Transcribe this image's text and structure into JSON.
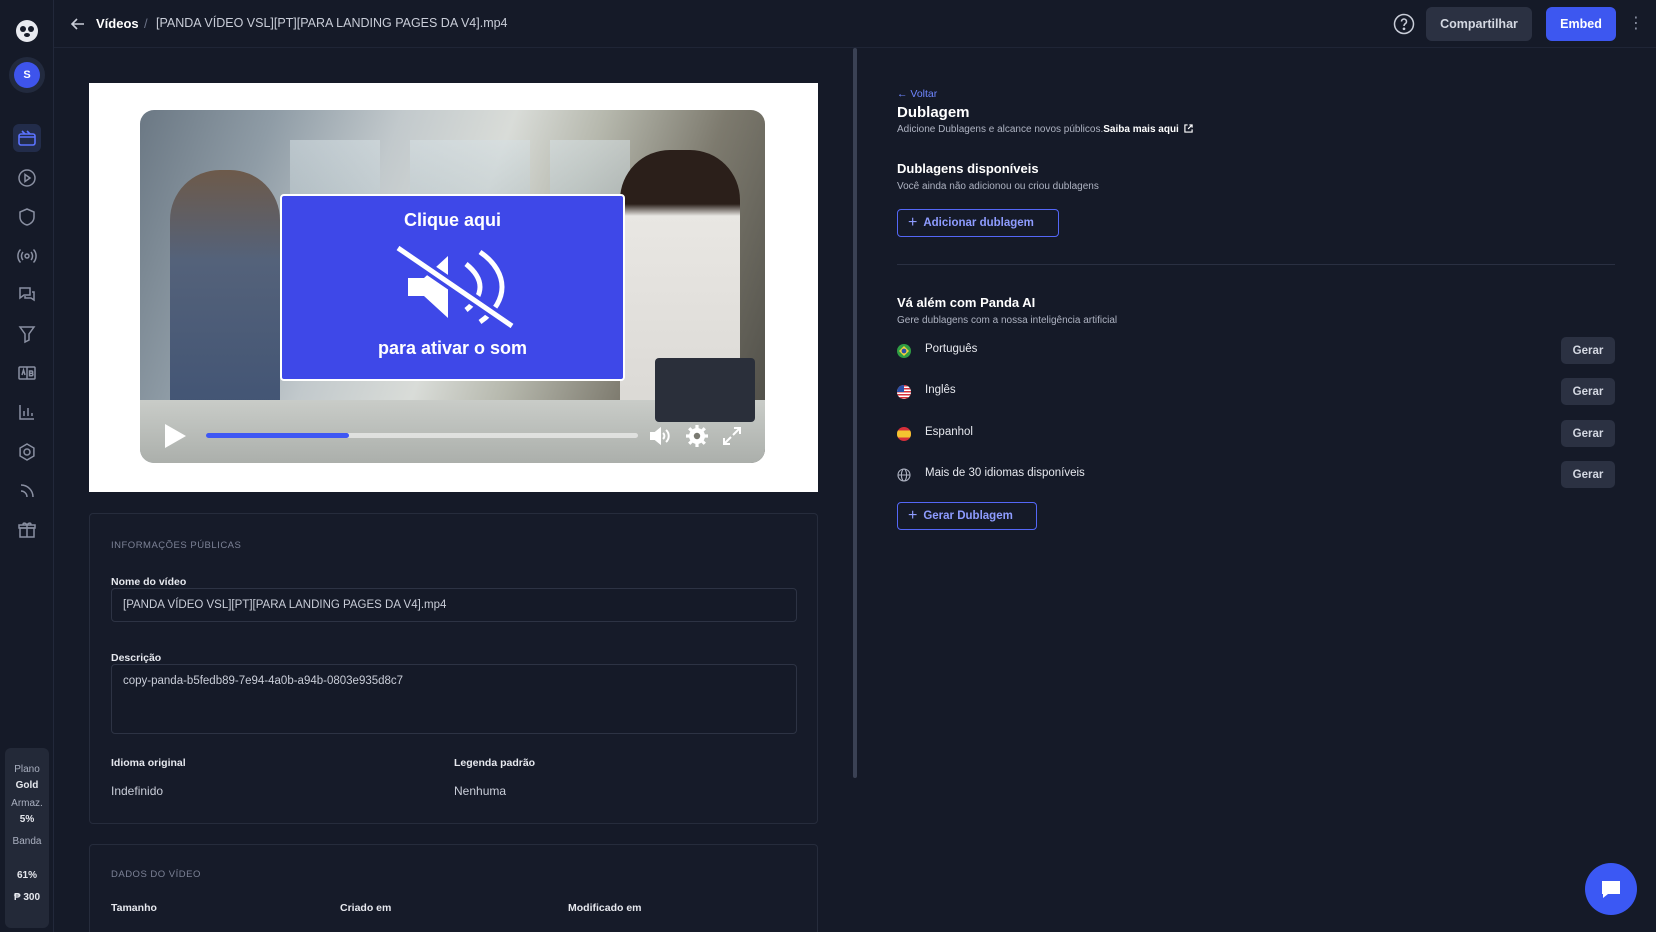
{
  "sidebar": {
    "avatar_initial": "S",
    "icons": [
      "logo-icon",
      "videos-icon",
      "player-icon",
      "shield-icon",
      "live-icon",
      "chat-icon",
      "funnel-icon",
      "ab-test-icon",
      "analytics-icon",
      "settings-icon",
      "rss-icon",
      "gift-icon"
    ],
    "plan": {
      "plan_label": "Plano",
      "plan_value": "Gold",
      "storage_label": "Armaz.",
      "storage_value": "5%",
      "bandwidth_label": "Banda",
      "bandwidth_value": "61%",
      "credits_value": "₱ 300"
    }
  },
  "topbar": {
    "breadcrumb_root": "Vídeos",
    "breadcrumb_sep": "/",
    "breadcrumb_file": "[PANDA VÍDEO VSL][PT][PARA LANDING PAGES DA V4].mp4",
    "share_label": "Compartilhar",
    "embed_label": "Embed"
  },
  "player": {
    "overlay_top": "Clique aqui",
    "overlay_bottom": "para ativar o som",
    "progress_fraction": 0.33
  },
  "public_info": {
    "section_title": "INFORMAÇÕES PÚBLICAS",
    "name_label": "Nome do vídeo",
    "name_value": "[PANDA VÍDEO VSL][PT][PARA LANDING PAGES DA V4].mp4",
    "desc_label": "Descrição",
    "desc_value": "copy-panda-b5fedb89-7e94-4a0b-a94b-0803e935d8c7",
    "orig_lang_label": "Idioma original",
    "orig_lang_value": "Indefinido",
    "default_sub_label": "Legenda padrão",
    "default_sub_value": "Nenhuma"
  },
  "video_data": {
    "section_title": "DADOS DO VÍDEO",
    "size_label": "Tamanho",
    "created_label": "Criado em",
    "modified_label": "Modificado em"
  },
  "dubbing": {
    "back_label": "← Voltar",
    "title": "Dublagem",
    "subtitle": "Adicione Dublagens e alcance novos públicos.",
    "learn_more": "Saiba mais aqui",
    "available_title": "Dublagens disponíveis",
    "available_empty": "Você ainda não adicionou ou criou dublagens",
    "add_button": "Adicionar dublagem",
    "ai_title": "Vá além com Panda AI",
    "ai_subtitle": "Gere dublagens com a nossa inteligência artificial",
    "languages": [
      {
        "name": "Português",
        "flag": "brazil-flag-icon",
        "action": "Gerar"
      },
      {
        "name": "Inglês",
        "flag": "usa-flag-icon",
        "action": "Gerar"
      },
      {
        "name": "Espanhol",
        "flag": "spain-flag-icon",
        "action": "Gerar"
      },
      {
        "name": "Mais de 30 idiomas disponíveis",
        "flag": "globe-icon",
        "action": "Gerar"
      }
    ],
    "generate_button": "Gerar Dublagem"
  },
  "colors": {
    "accent": "#3d57f0",
    "background": "#151a28",
    "link": "#6f86ff"
  }
}
